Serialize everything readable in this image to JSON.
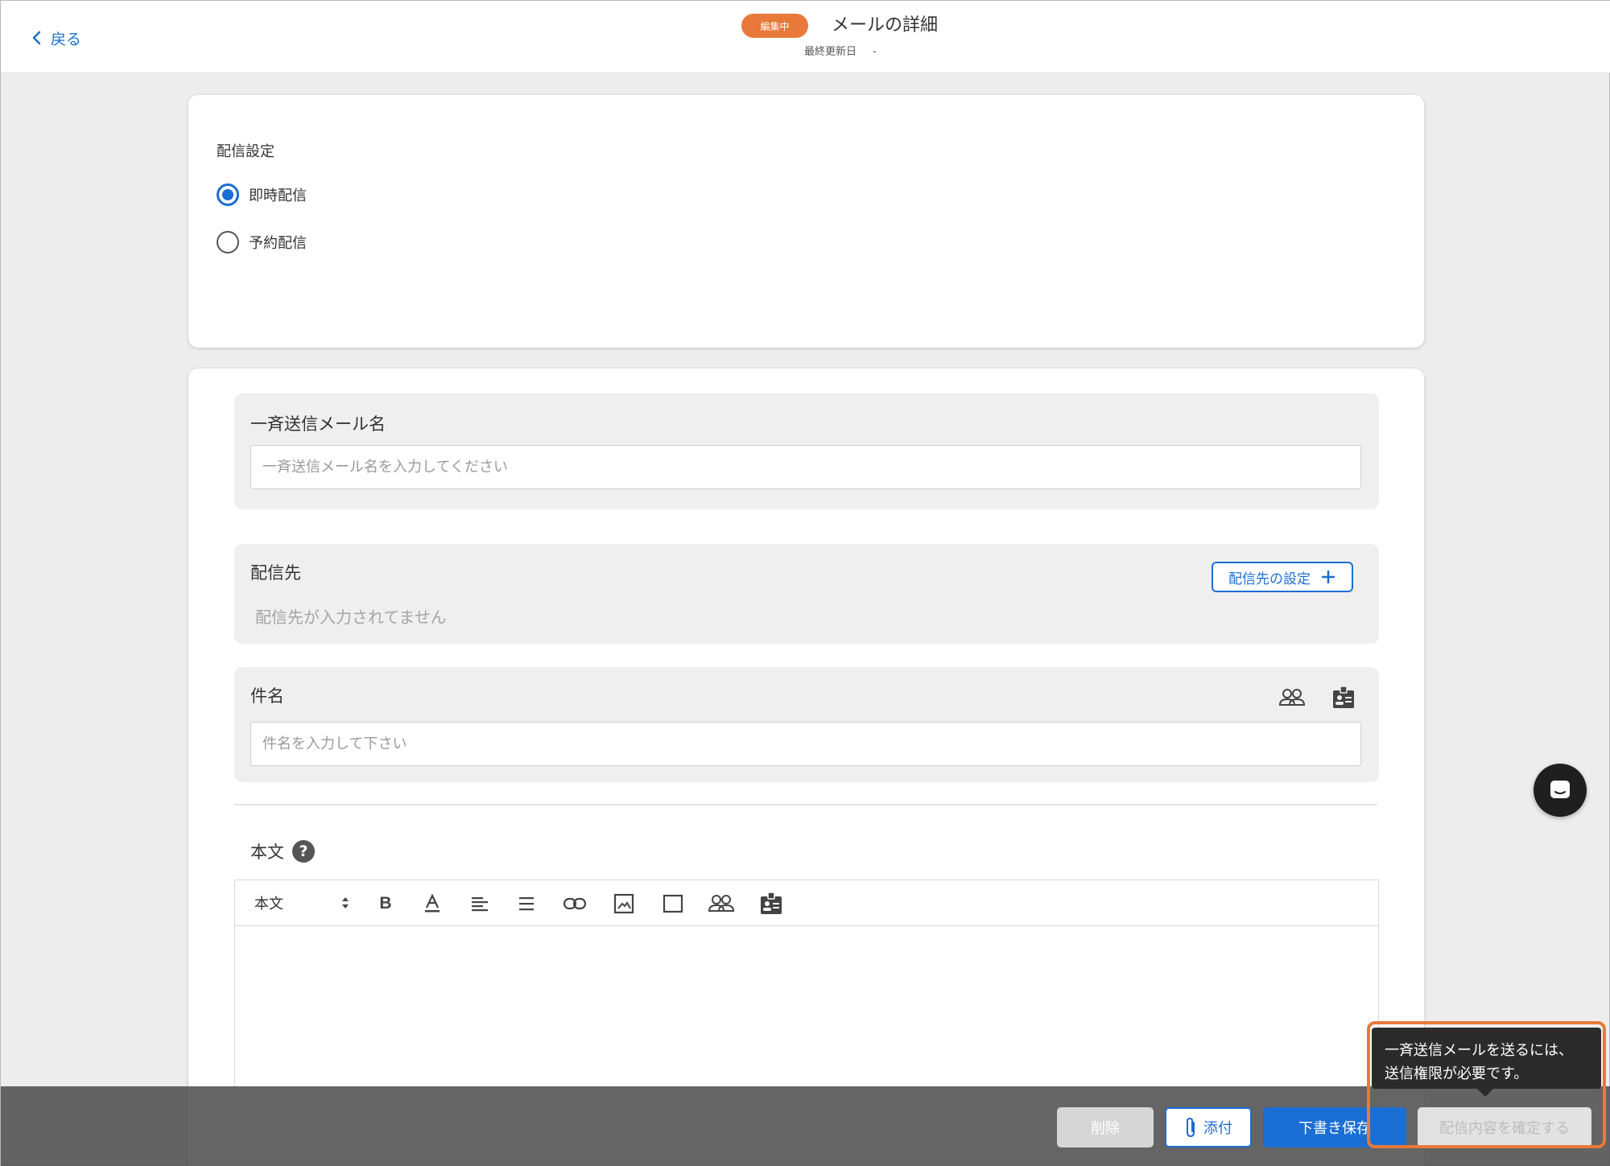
{
  "header": {
    "back_label": "戻る",
    "status_badge": "編集中",
    "title": "メールの詳細",
    "last_updated_label": "最終更新日",
    "last_updated_value": "-"
  },
  "delivery": {
    "section_label": "配信設定",
    "options": [
      {
        "label": "即時配信",
        "selected": true
      },
      {
        "label": "予約配信",
        "selected": false
      }
    ]
  },
  "mail_name": {
    "label": "一斉送信メール名",
    "placeholder": "一斉送信メール名を入力してください",
    "value": ""
  },
  "recipients": {
    "label": "配信先",
    "setup_button": "配信先の設定",
    "empty_text": "配信先が入力されてません"
  },
  "subject": {
    "label": "件名",
    "placeholder": "件名を入力して下さい",
    "value": ""
  },
  "body": {
    "label": "本文",
    "help_icon": "?",
    "style_select": "本文",
    "toolbar_icons": [
      "bold-icon",
      "font-color-icon",
      "align-left-icon",
      "list-icon",
      "link-icon",
      "image-icon",
      "box-icon",
      "people-icon",
      "id-card-icon"
    ]
  },
  "actions": {
    "delete": "削除",
    "attach": "添付",
    "save_draft": "下書き保存",
    "confirm": "配信内容を確定する"
  },
  "tooltip": {
    "line1": "一斉送信メールを送るには、",
    "line2": "送信権限が必要です。"
  },
  "colors": {
    "accent": "#1b6ed3",
    "badge": "#e8793a",
    "highlight": "#e8793a"
  }
}
